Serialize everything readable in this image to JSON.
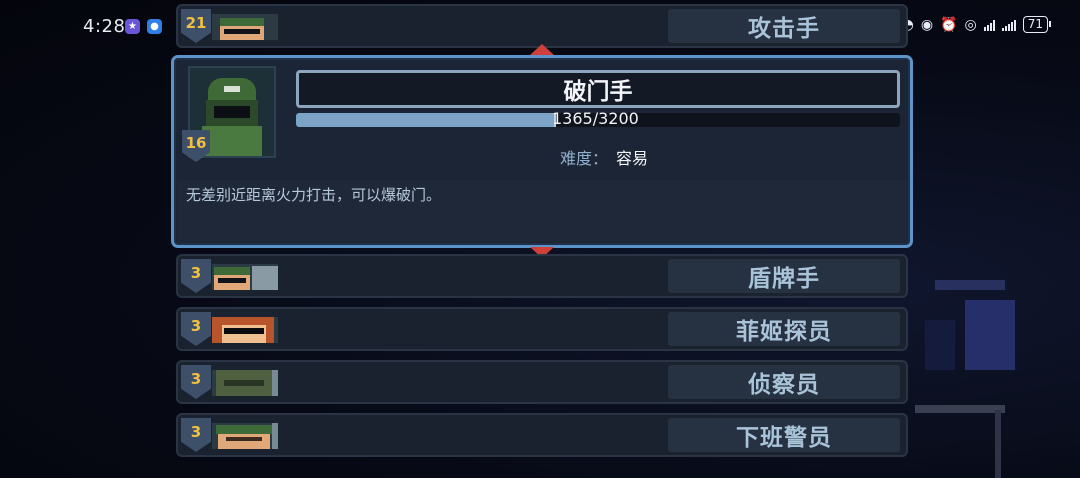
{
  "status_bar": {
    "time": "4:28",
    "battery": "71",
    "icons": [
      "data-speed-icon",
      "eye-icon",
      "alarm-icon",
      "hotspot-icon",
      "signal-icon",
      "signal-icon-2",
      "battery-icon"
    ]
  },
  "characters": [
    {
      "level": "21",
      "name": "攻击手"
    },
    {
      "level": "3",
      "name": "盾牌手"
    },
    {
      "level": "3",
      "name": "菲姬探员"
    },
    {
      "level": "3",
      "name": "侦察员"
    },
    {
      "level": "3",
      "name": "下班警员"
    }
  ],
  "selected": {
    "level": "16",
    "name": "破门手",
    "xp_current": 1365,
    "xp_max": 3200,
    "xp_text": "1365/3200",
    "difficulty_label": "难度：",
    "difficulty_value": "容易",
    "description": "无差别近距离火力打击，可以爆破门。"
  },
  "colors": {
    "accent_border": "#5c93c8",
    "level_badge_text": "#f0c040",
    "arrow": "#d0403a"
  }
}
